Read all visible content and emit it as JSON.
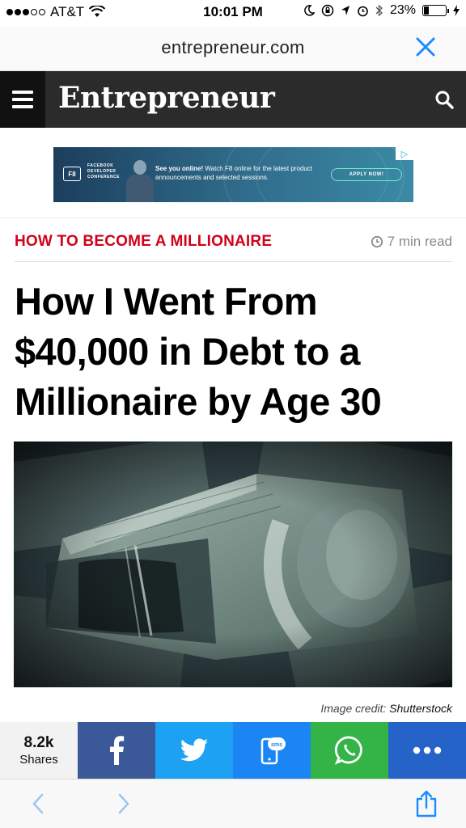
{
  "status_bar": {
    "carrier": "AT&T",
    "time": "10:01 PM",
    "battery": "23%",
    "battery_level": 0.23
  },
  "browser": {
    "url": "entrepreneur.com"
  },
  "site": {
    "logo": "Entrepreneur"
  },
  "ad": {
    "f8_badge": "F8",
    "conference": "FACEBOOK DEVELOPER CONFERENCE",
    "headline": "See you online!",
    "body": "Watch F8 online for the latest product announcements and selected sessions.",
    "cta": "APPLY NOW!"
  },
  "article": {
    "category": "HOW TO BECOME A MILLIONAIRE",
    "read_time": "7 min read",
    "headline": "How I Went From $40,000 in Debt to a Millionaire by Age 30",
    "image_credit_label": "Image credit:",
    "image_credit_source": "Shutterstock"
  },
  "share": {
    "count": "8.2k",
    "label": "Shares"
  },
  "icons": {
    "menu": "menu-icon",
    "search": "search-icon",
    "close": "close-icon",
    "clock": "clock-icon",
    "facebook": "facebook-icon",
    "twitter": "twitter-icon",
    "sms": "sms-icon",
    "whatsapp": "whatsapp-icon",
    "more": "more-icon",
    "back": "back-icon",
    "forward": "forward-icon",
    "share": "share-icon"
  },
  "colors": {
    "category_red": "#d0021b",
    "header_bg": "#2b2b2b",
    "facebook": "#3b5998",
    "twitter": "#1da1f2",
    "sms": "#1b86f3",
    "whatsapp": "#34b447",
    "more": "#2563c9",
    "ios_blue": "#1a8cff"
  }
}
